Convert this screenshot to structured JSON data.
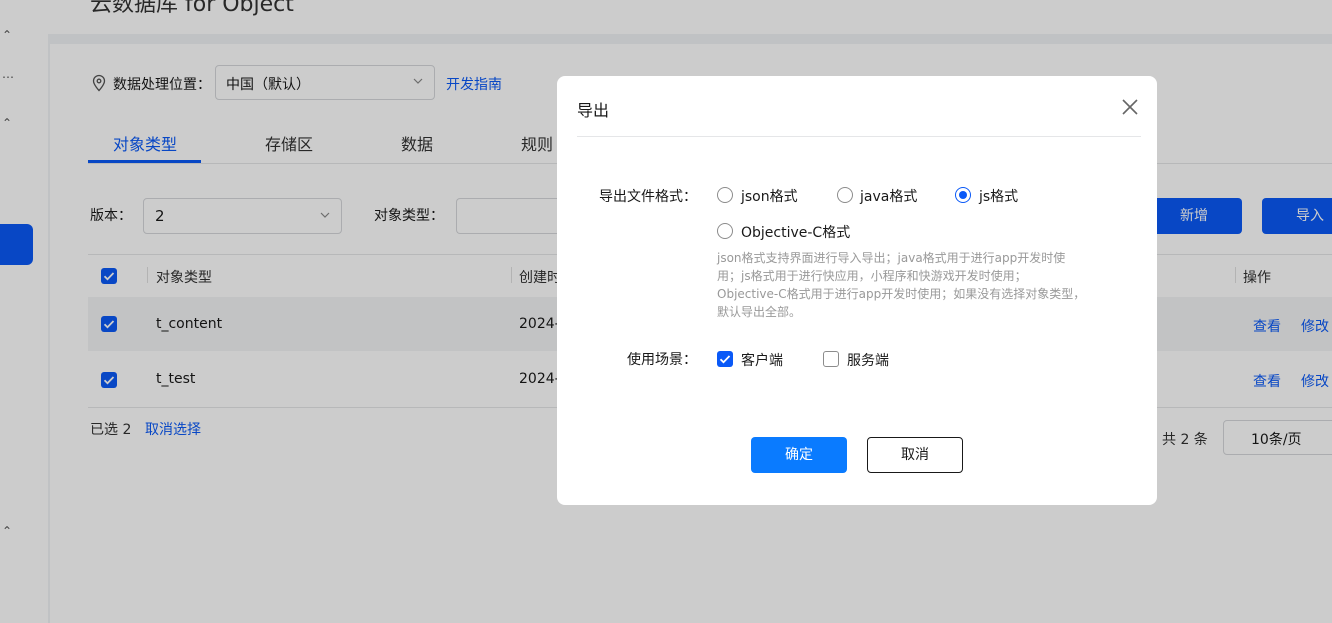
{
  "page": {
    "title": "云数据库 for Object"
  },
  "location": {
    "label": "数据处理位置：",
    "value": "中国（默认）",
    "guide_link": "开发指南"
  },
  "tabs": [
    {
      "label": "对象类型"
    },
    {
      "label": "存储区"
    },
    {
      "label": "数据"
    },
    {
      "label": "规则"
    }
  ],
  "filters": {
    "version_label": "版本：",
    "version_value": "2",
    "type_label": "对象类型："
  },
  "actions": {
    "new_label": "新增",
    "import_label": "导入"
  },
  "table": {
    "headers": [
      "对象类型",
      "创建时",
      "操作"
    ],
    "rows": [
      {
        "name": "t_content",
        "created": "2024-",
        "view": "查看",
        "edit": "修改"
      },
      {
        "name": "t_test",
        "created": "2024-",
        "view": "查看",
        "edit": "修改"
      }
    ]
  },
  "footer": {
    "selected": "已选 2",
    "cancel_selection": "取消选择",
    "total": "共 2 条",
    "page_size": "10条/页"
  },
  "dialog": {
    "title": "导出",
    "format_label": "导出文件格式：",
    "formats": [
      {
        "label": "json格式",
        "checked": false
      },
      {
        "label": "java格式",
        "checked": false
      },
      {
        "label": "js格式",
        "checked": true
      },
      {
        "label": "Objective-C格式",
        "checked": false
      }
    ],
    "hint_lines": [
      "json格式支持界面进行导入导出；java格式用于进行app开发时使",
      "用；js格式用于进行快应用，小程序和快游戏开发时使用；",
      "Objective-C格式用于进行app开发时使用；如果没有选择对象类型，",
      "默认导出全部。"
    ],
    "scene_label": "使用场景：",
    "scenes": [
      {
        "label": "客户端",
        "checked": true
      },
      {
        "label": "服务端",
        "checked": false
      }
    ],
    "ok_label": "确定",
    "cancel_label": "取消"
  },
  "colors": {
    "primary": "#0a59f7",
    "ok_button": "#0a7bff"
  }
}
